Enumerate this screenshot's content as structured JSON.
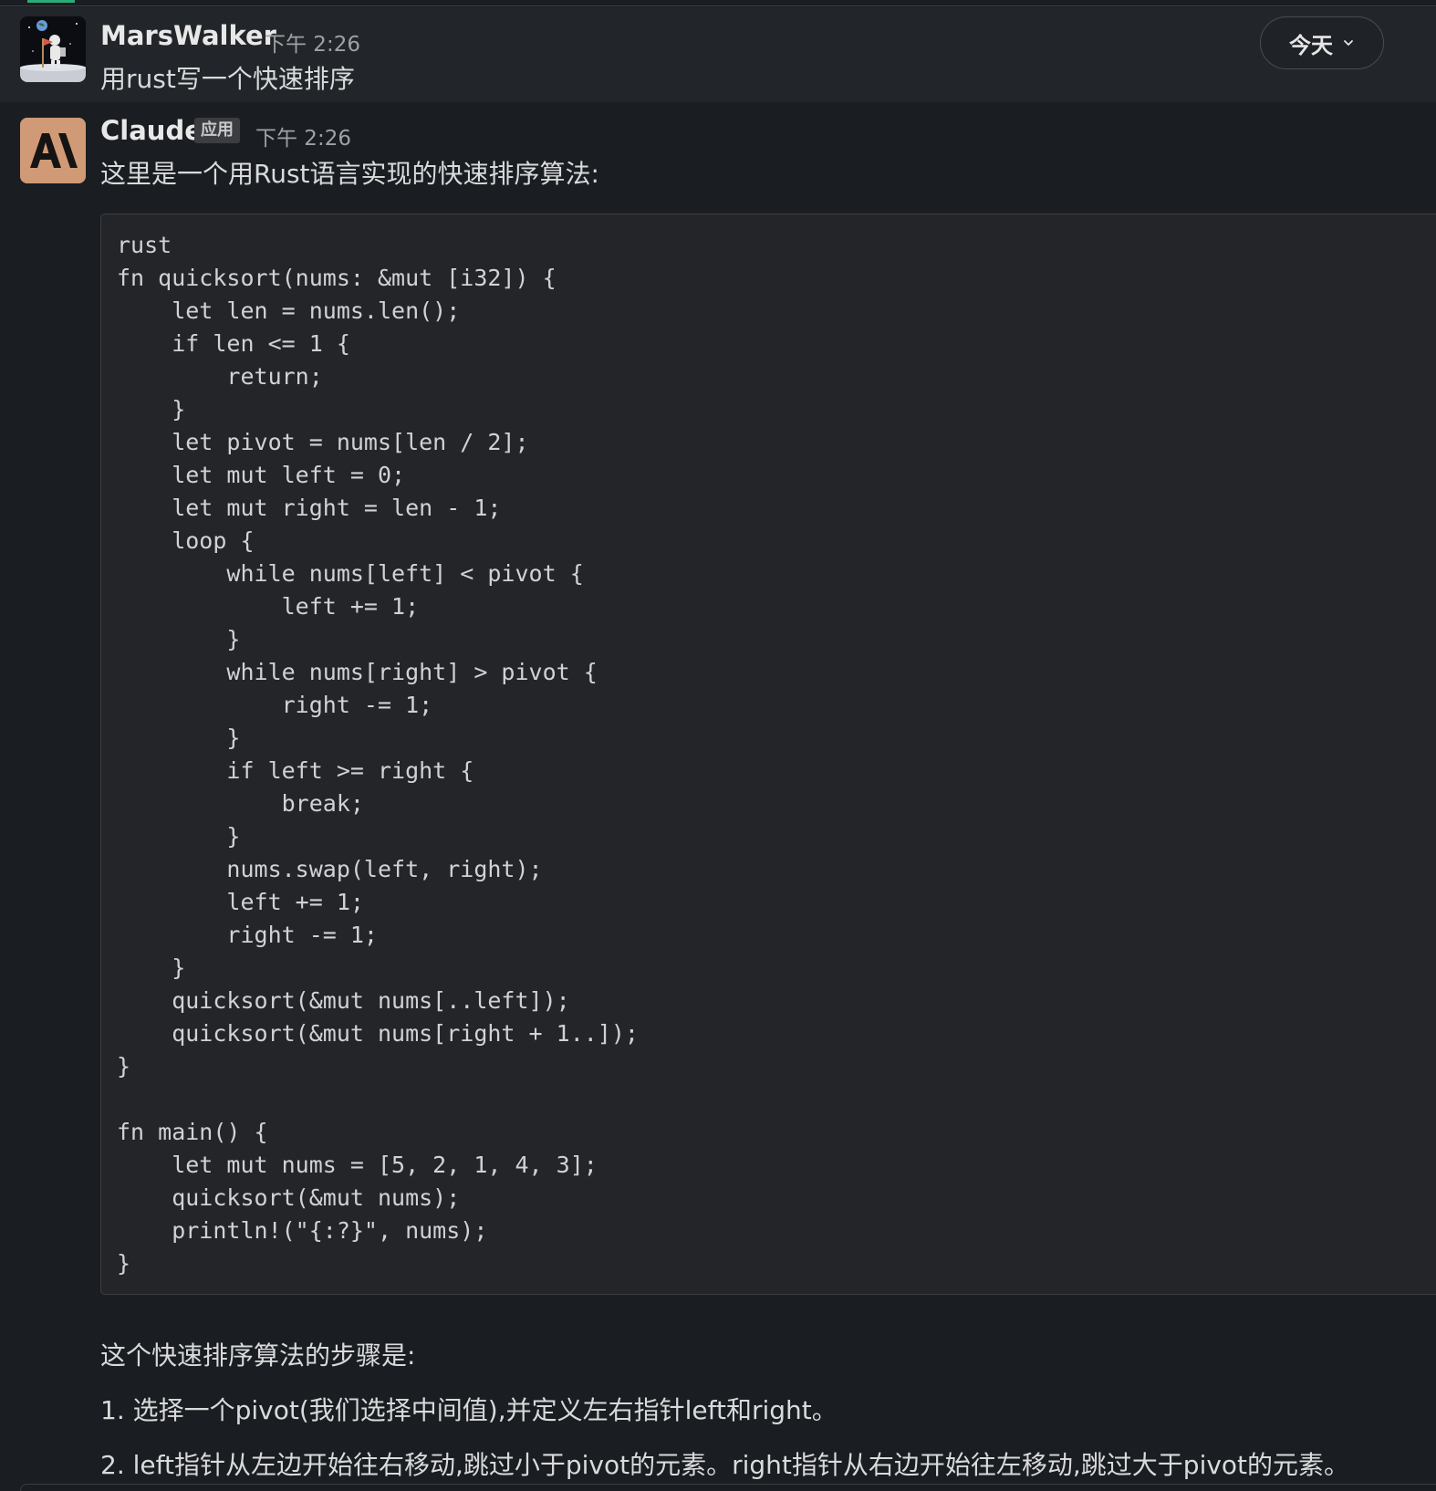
{
  "date_divider": {
    "label": "今天"
  },
  "messages": [
    {
      "author": "MarsWalker",
      "time": "下午 2:26",
      "text": "用rust写一个快速排序"
    },
    {
      "author": "Claude",
      "badge": "应用",
      "time": "下午 2:26",
      "intro": "这里是一个用Rust语言实现的快速排序算法:",
      "code": "rust\nfn quicksort(nums: &mut [i32]) {\n    let len = nums.len();\n    if len <= 1 {\n        return;\n    }\n    let pivot = nums[len / 2];\n    let mut left = 0;\n    let mut right = len - 1;\n    loop {\n        while nums[left] < pivot {\n            left += 1;\n        }\n        while nums[right] > pivot {\n            right -= 1;\n        }\n        if left >= right {\n            break;\n        }\n        nums.swap(left, right);\n        left += 1;\n        right -= 1;\n    }\n    quicksort(&mut nums[..left]);\n    quicksort(&mut nums[right + 1..]);\n}\n\nfn main() {\n    let mut nums = [5, 2, 1, 4, 3];\n    quicksort(&mut nums);\n    println!(\"{:?}\", nums);\n}",
      "steps_heading": "这个快速排序算法的步骤是:",
      "steps": [
        "1. 选择一个pivot(我们选择中间值),并定义左右指针left和right。",
        "2. left指针从左边开始往右移动,跳过小于pivot的元素。right指针从右边开始往左移动,跳过大于pivot的元素。"
      ]
    }
  ],
  "colors": {
    "background": "#1a1d21",
    "hover_row": "#222529",
    "code_bg": "#232529",
    "accent_green": "#2bac76",
    "claude_avatar": "#d09a76"
  }
}
